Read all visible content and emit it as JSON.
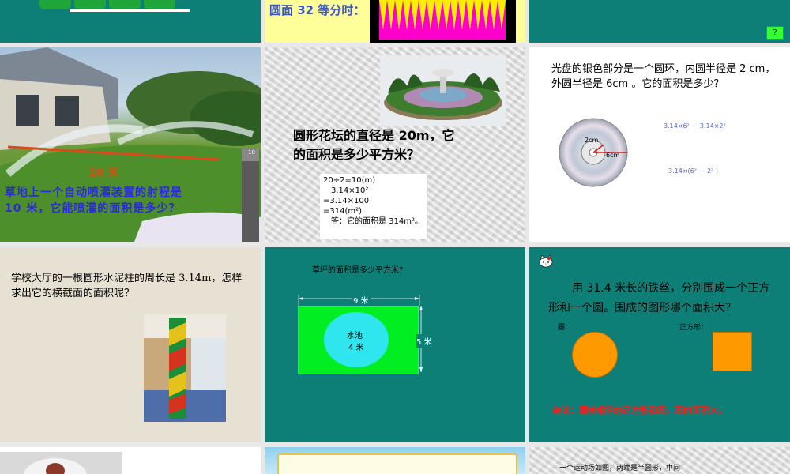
{
  "top_row": {
    "slide2_caption": "圆面 32 等分时：",
    "slide3_button": "?"
  },
  "sprinkler": {
    "distance_label": "10 米",
    "question": "草地上一个自动喷灌装置的射程是 10 米，它能喷灌的面积是多少？",
    "sign_number": "10"
  },
  "flowerbed": {
    "question": "圆形花坛的直径是 20m，它的面积是多少平方米？",
    "solution_lines": [
      "20÷2=10(m)",
      "3.14×10²",
      "=3.14×100",
      "=314(m²)",
      "答：它的面积是 314m²。"
    ]
  },
  "cd": {
    "question": "光盘的银色部分是一个圆环，内圆半径是 2 cm，外圆半径是 6cm 。它的面积是多少？",
    "inner_label": "2cm",
    "outer_label": "6cm",
    "formula1": "3.14×6² － 3.14×2²",
    "formula2": "3.14×(6² － 2² )"
  },
  "pillar": {
    "question": "学校大厅的一根圆形水泥柱的周长是 3.14m，怎样求出它的横截面的面积呢？"
  },
  "lawn": {
    "question": "草坪的面积是多少平方米?",
    "width_label": "9 米",
    "height_label": "5 米",
    "pool_name": "水池",
    "pool_radius": "4 米"
  },
  "wire": {
    "question": "用 31.4 米长的铁丝，分别围成一个正方形和一个圆。围成的图形哪个面积大？",
    "circle_label": "圆：",
    "square_label": "正方形：",
    "conclusion": "结论：周长相等的正方形和圆，圆的面积大。"
  },
  "bottom_row": {
    "track_text": "一个运动场如图，两端是半圆形，中间"
  }
}
